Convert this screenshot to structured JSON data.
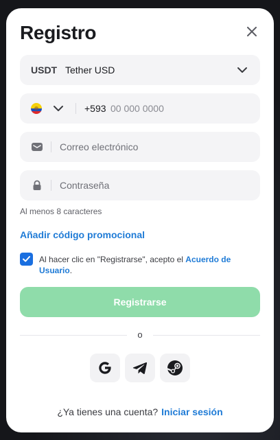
{
  "modal": {
    "title": "Registro"
  },
  "currency": {
    "code": "USDT",
    "name": "Tether USD"
  },
  "phone": {
    "country_code": "+593",
    "placeholder": "00 000 0000"
  },
  "email": {
    "placeholder": "Correo electrónico"
  },
  "password": {
    "placeholder": "Contraseña",
    "hint": "Al menos 8 caracteres"
  },
  "promo": {
    "label": "Añadir código promocional"
  },
  "terms": {
    "text": "Al hacer clic en \"Registrarse\", acepto el ",
    "link": "Acuerdo de Usuario",
    "suffix": ".",
    "checked": true
  },
  "submit": {
    "label": "Registrarse"
  },
  "divider": {
    "label": "o"
  },
  "social": [
    "google-icon",
    "telegram-icon",
    "steam-icon"
  ],
  "footer": {
    "question": "¿Ya tienes una cuenta?",
    "login": "Iniciar sesión"
  },
  "colors": {
    "accent": "#1f7bd6",
    "submit": "#8fdcaa",
    "checkbox": "#1a6fe0"
  }
}
